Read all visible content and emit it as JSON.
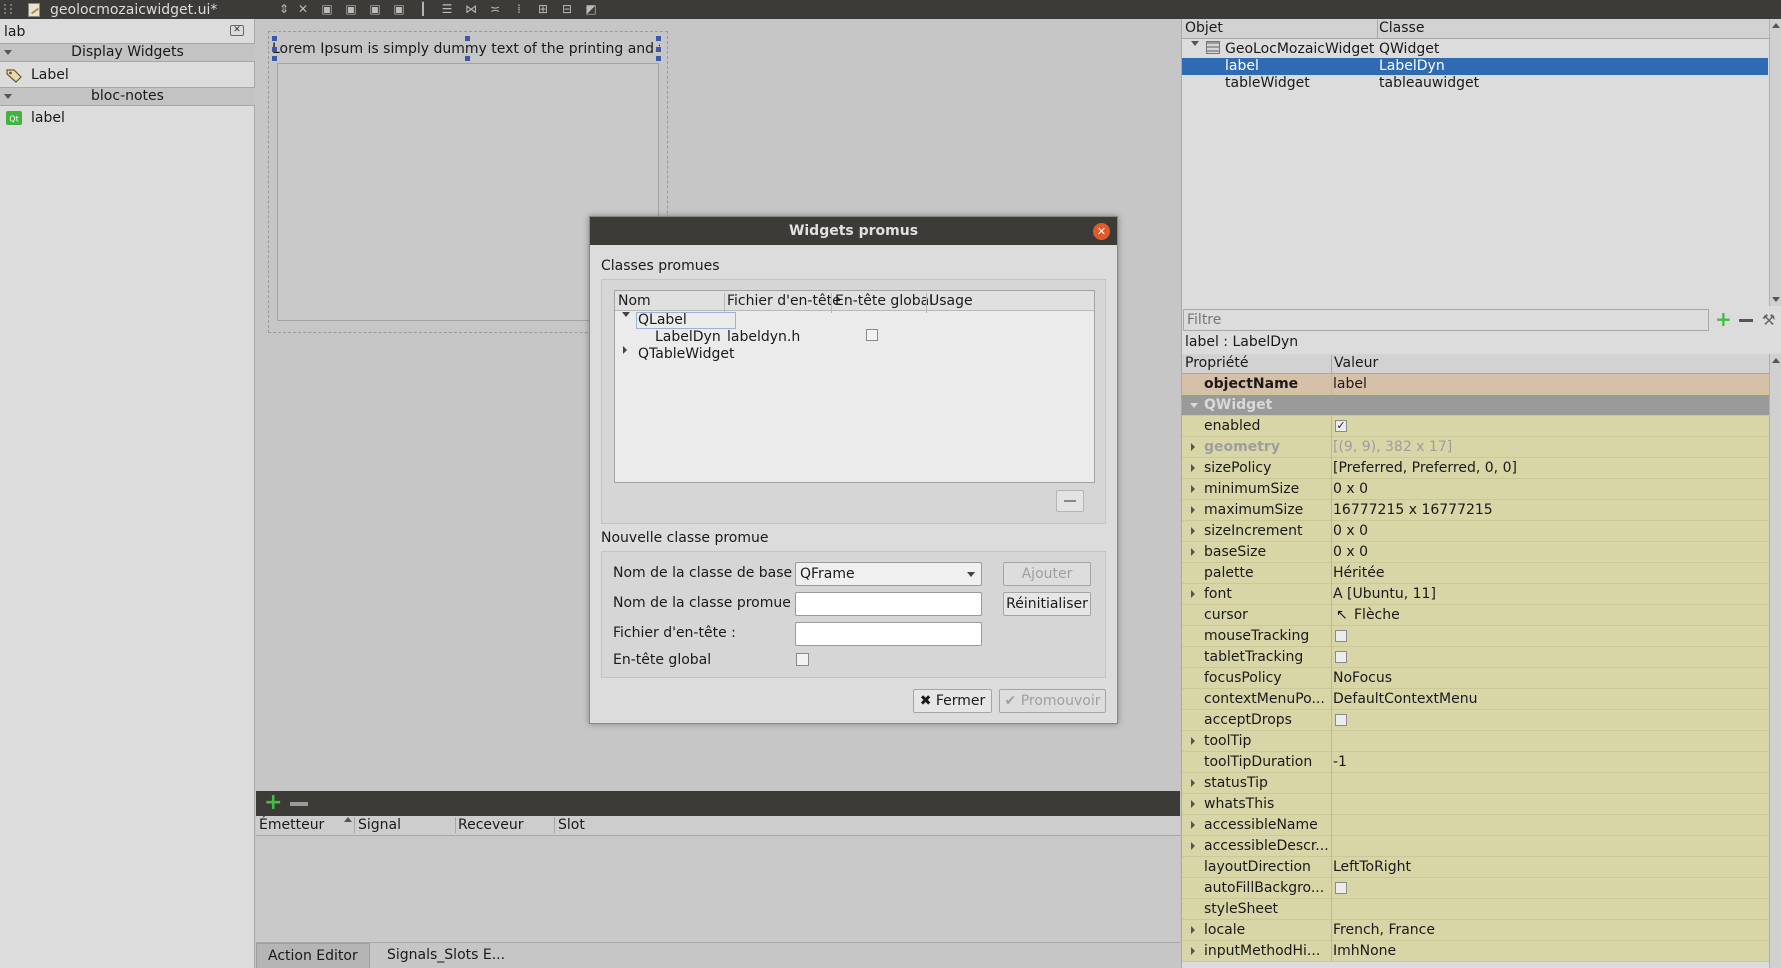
{
  "window": {
    "file_tab": "geolocmozaicwidget.ui*"
  },
  "widget_box": {
    "search_value": "lab",
    "categories": [
      {
        "title": "Display Widgets",
        "items": [
          {
            "label": "Label",
            "icon": "label-tag-icon"
          }
        ]
      },
      {
        "title": "bloc-notes",
        "items": [
          {
            "label": "label",
            "icon": "qt-icon"
          }
        ]
      }
    ]
  },
  "form": {
    "label_text": "Lorem Ipsum is simply dummy text of the printing and ty"
  },
  "signal_slot_editor": {
    "columns": [
      "Émetteur",
      "Signal",
      "Receveur",
      "Slot"
    ],
    "tabs": [
      "Action Editor",
      "Signals_Slots E..."
    ]
  },
  "object_inspector": {
    "columns": [
      "Objet",
      "Classe"
    ],
    "rows": [
      {
        "object": "GeoLocMozaicWidget",
        "class": "QWidget"
      },
      {
        "object": "label",
        "class": "LabelDyn"
      },
      {
        "object": "tableWidget",
        "class": "tableauwidget"
      }
    ]
  },
  "property_editor": {
    "filter_placeholder": "Filtre",
    "class_line": "label : LabelDyn",
    "columns": [
      "Propriété",
      "Valeur"
    ],
    "rows": [
      {
        "name": "objectName",
        "value": "label"
      },
      {
        "name": "QWidget",
        "value": ""
      },
      {
        "name": "enabled",
        "value": "✓"
      },
      {
        "name": "geometry",
        "value": "[(9, 9), 382 x 17]"
      },
      {
        "name": "sizePolicy",
        "value": "[Preferred, Preferred, 0, 0]"
      },
      {
        "name": "minimumSize",
        "value": "0 x 0"
      },
      {
        "name": "maximumSize",
        "value": "16777215 x 16777215"
      },
      {
        "name": "sizeIncrement",
        "value": "0 x 0"
      },
      {
        "name": "baseSize",
        "value": "0 x 0"
      },
      {
        "name": "palette",
        "value": "Héritée"
      },
      {
        "name": "font",
        "value": "A  [Ubuntu, 11]"
      },
      {
        "name": "cursor",
        "value": "Flèche"
      },
      {
        "name": "mouseTracking",
        "value": ""
      },
      {
        "name": "tabletTracking",
        "value": ""
      },
      {
        "name": "focusPolicy",
        "value": "NoFocus"
      },
      {
        "name": "contextMenuPo...",
        "value": "DefaultContextMenu"
      },
      {
        "name": "acceptDrops",
        "value": ""
      },
      {
        "name": "toolTip",
        "value": ""
      },
      {
        "name": "toolTipDuration",
        "value": "-1"
      },
      {
        "name": "statusTip",
        "value": ""
      },
      {
        "name": "whatsThis",
        "value": ""
      },
      {
        "name": "accessibleName",
        "value": ""
      },
      {
        "name": "accessibleDescr...",
        "value": ""
      },
      {
        "name": "layoutDirection",
        "value": "LeftToRight"
      },
      {
        "name": "autoFillBackgro...",
        "value": ""
      },
      {
        "name": "styleSheet",
        "value": ""
      },
      {
        "name": "locale",
        "value": "French, France"
      },
      {
        "name": "inputMethodHi...",
        "value": "ImhNone"
      }
    ]
  },
  "dialog": {
    "title": "Widgets promus",
    "promoted_group": "Classes promues",
    "tree_columns": [
      "Nom",
      "Fichier d'en-tête",
      "En-tête global",
      "Usage"
    ],
    "tree_rows": [
      {
        "name": "QLabel",
        "header": ""
      },
      {
        "name": "LabelDyn",
        "header": "labeldyn.h"
      },
      {
        "name": "QTableWidget",
        "header": ""
      }
    ],
    "new_group": "Nouvelle classe promue",
    "base_class_label": "Nom de la classe de base :",
    "base_class_value": "QFrame",
    "promoted_class_label": "Nom de la classe promue :",
    "header_file_label": "Fichier d'en-tête :",
    "global_include_label": "En-tête global",
    "add_button": "Ajouter",
    "reset_button": "Réinitialiser",
    "close_button": "Fermer",
    "promote_button": "Promouvoir"
  }
}
